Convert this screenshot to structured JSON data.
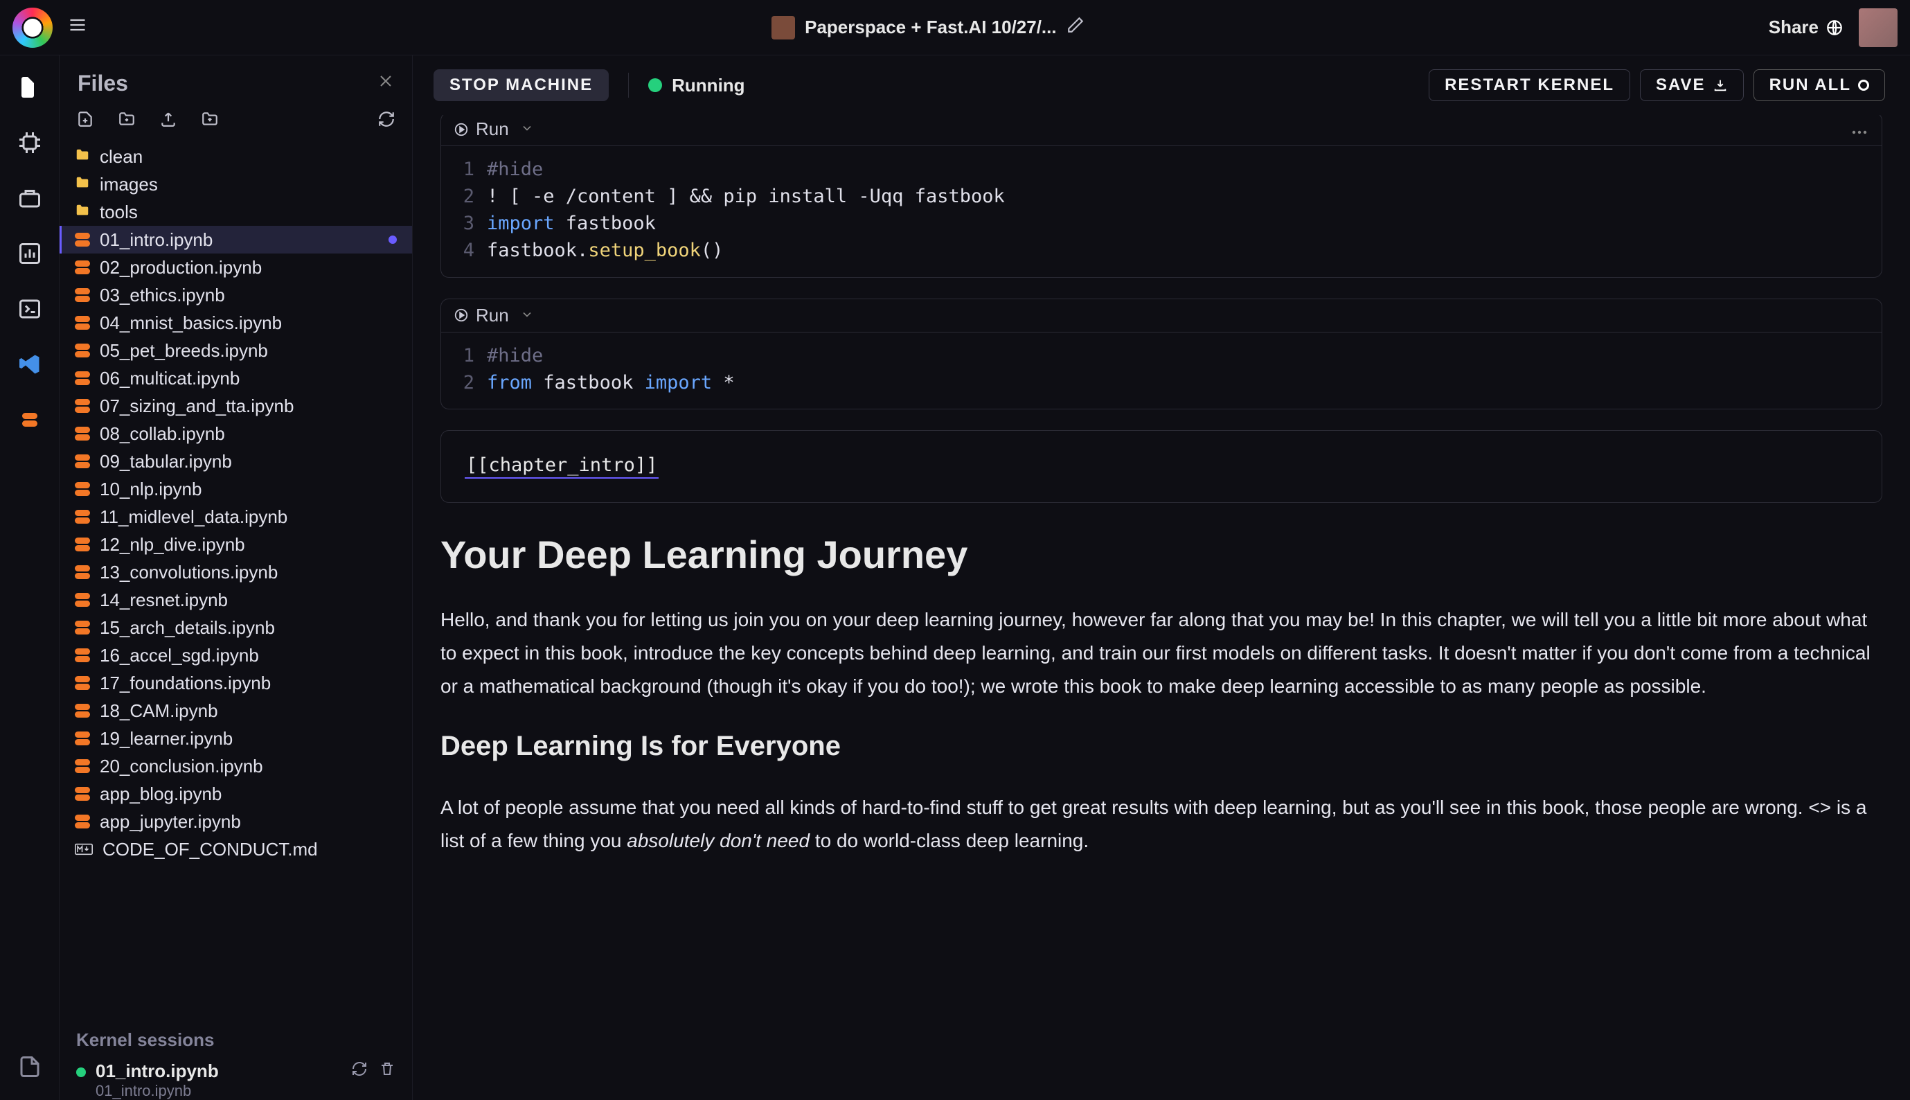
{
  "project_title": "Paperspace + Fast.AI 10/27/...",
  "share_label": "Share",
  "stop_machine_label": "STOP MACHINE",
  "status_label": "Running",
  "restart_kernel_label": "RESTART KERNEL",
  "save_label": "SAVE",
  "run_all_label": "RUN ALL",
  "sidebar": {
    "title": "Files",
    "folders": [
      "clean",
      "images",
      "tools"
    ],
    "files": [
      "01_intro.ipynb",
      "02_production.ipynb",
      "03_ethics.ipynb",
      "04_mnist_basics.ipynb",
      "05_pet_breeds.ipynb",
      "06_multicat.ipynb",
      "07_sizing_and_tta.ipynb",
      "08_collab.ipynb",
      "09_tabular.ipynb",
      "10_nlp.ipynb",
      "11_midlevel_data.ipynb",
      "12_nlp_dive.ipynb",
      "13_convolutions.ipynb",
      "14_resnet.ipynb",
      "15_arch_details.ipynb",
      "16_accel_sgd.ipynb",
      "17_foundations.ipynb",
      "18_CAM.ipynb",
      "19_learner.ipynb",
      "20_conclusion.ipynb",
      "app_blog.ipynb",
      "app_jupyter.ipynb"
    ],
    "md_file": "CODE_OF_CONDUCT.md",
    "selected_index": 0
  },
  "kernel": {
    "section_title": "Kernel sessions",
    "name": "01_intro.ipynb",
    "path": "01_intro.ipynb"
  },
  "cells": {
    "run_label": "Run",
    "c1": {
      "l1": "#hide",
      "l2": "! [ -e /content ] && pip install -Uqq fastbook",
      "l3a": "import",
      "l3b": " fastbook",
      "l4a": "fastbook.",
      "l4b": "setup_book",
      "l4c": "()"
    },
    "c2": {
      "l1": "#hide",
      "l2a": "from",
      "l2b": " fastbook ",
      "l2c": "import",
      "l2d": " *"
    },
    "chapter_tag": "[[chapter_intro]]",
    "h1": "Your Deep Learning Journey",
    "p1": "Hello, and thank you for letting us join you on your deep learning journey, however far along that you may be! In this chapter, we will tell you a little bit more about what to expect in this book, introduce the key concepts behind deep learning, and train our first models on different tasks. It doesn't matter if you don't come from a technical or a mathematical background (though it's okay if you do too!); we wrote this book to make deep learning accessible to as many people as possible.",
    "h2": "Deep Learning Is for Everyone",
    "p2a": "A lot of people assume that you need all kinds of hard-to-find stuff to get great results with deep learning, but as you'll see in this book, those people are wrong. <> is a list of a few thing you ",
    "p2b": "absolutely don't need",
    "p2c": " to do world-class deep learning."
  }
}
